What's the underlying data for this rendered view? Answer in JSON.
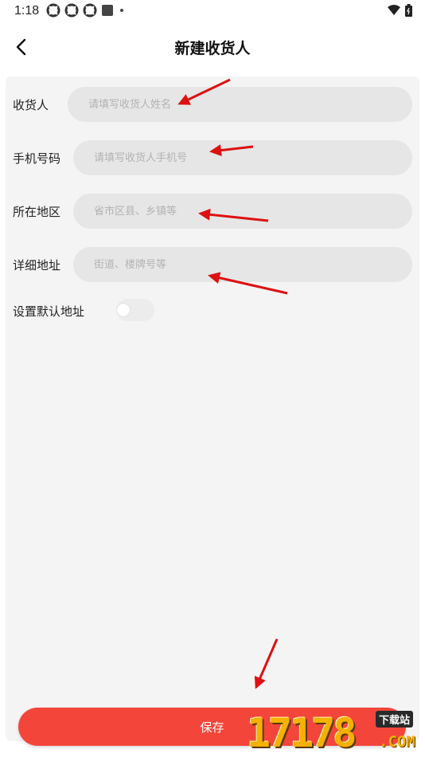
{
  "status_bar": {
    "time": "1:18",
    "left_icons": [
      "sync-icon",
      "sync-icon",
      "sync-icon",
      "square-icon",
      "dot-icon"
    ],
    "right_icons": [
      "wifi-icon",
      "battery-icon"
    ]
  },
  "header": {
    "back_icon": "chevron-left-icon",
    "title": "新建收货人"
  },
  "form": {
    "recipient": {
      "label": "收货人",
      "placeholder": "请填写收货人姓名",
      "value": ""
    },
    "phone": {
      "label": "手机号码",
      "placeholder": "请填写收货人手机号",
      "value": ""
    },
    "region": {
      "label": "所在地区",
      "placeholder": "省市区县、乡镇等",
      "value": ""
    },
    "address": {
      "label": "详细地址",
      "placeholder": "街道、楼牌号等",
      "value": ""
    },
    "default_address": {
      "label": "设置默认地址",
      "enabled": false
    }
  },
  "save_button": {
    "label": "保存"
  },
  "watermark": {
    "digits": "17178",
    "tag": "下载站",
    "domain": ".COM"
  },
  "colors": {
    "accent": "#f4453b",
    "card_background": "#f4f4f4",
    "input_background": "#e6e6e6",
    "placeholder_text": "#b3b3b3",
    "annotation_arrow": "#dd1111"
  }
}
